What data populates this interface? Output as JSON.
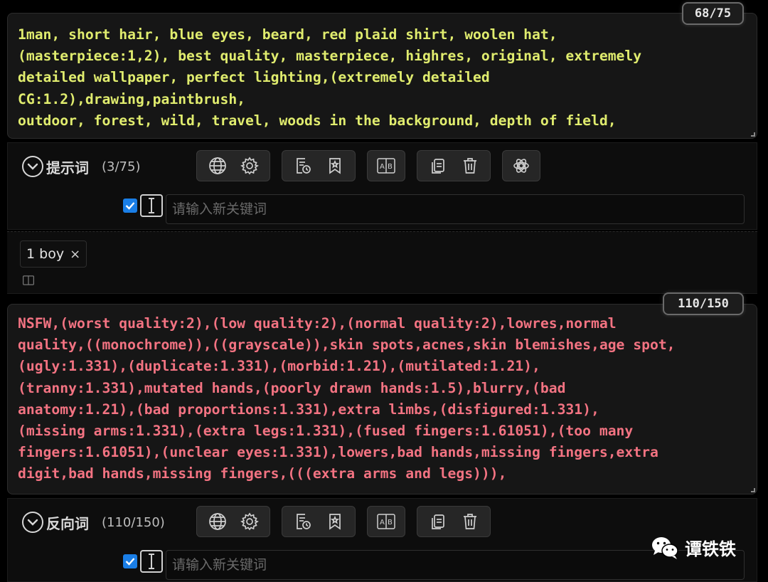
{
  "positive": {
    "text": "1man, short hair, blue eyes, beard, red plaid shirt, woolen hat,\n(masterpiece:1,2), best quality, masterpiece, highres, original, extremely\ndetailed wallpaper, perfect lighting,(extremely detailed\nCG:1.2),drawing,paintbrush,\noutdoor, forest, wild, travel, woods in the background, depth of field,",
    "counter": "68/75",
    "section_label": "提示词",
    "section_count": "(3/75)",
    "input_placeholder": "请输入新关键词",
    "tags": [
      {
        "label": "1 boy",
        "remove": "×"
      }
    ]
  },
  "negative": {
    "text": "NSFW,(worst quality:2),(low quality:2),(normal quality:2),lowres,normal\nquality,((monochrome)),((grayscale)),skin spots,acnes,skin blemishes,age spot,\n(ugly:1.331),(duplicate:1.331),(morbid:1.21),(mutilated:1.21),\n(tranny:1.331),mutated hands,(poorly drawn hands:1.5),blurry,(bad\nanatomy:1.21),(bad proportions:1.331),extra limbs,(disfigured:1.331),\n(missing arms:1.331),(extra legs:1.331),(fused fingers:1.61051),(too many\nfingers:1.61051),(unclear eyes:1.331),lowers,bad hands,missing fingers,extra\ndigit,bad hands,missing fingers,(((extra arms and legs))),",
    "counter": "110/150",
    "section_label": "反向词",
    "section_count": "(110/150)",
    "input_placeholder": "请输入新关键词"
  },
  "toolbar_icons": [
    "globe-icon",
    "gear-icon",
    "history-icon",
    "bookmark-icon",
    "translate-icon",
    "copy-icon",
    "trash-icon",
    "openai-icon"
  ],
  "watermark": {
    "icon": "wechat-icon",
    "text": "谭铁铁"
  },
  "colors": {
    "positive_text": "#e0ec6e",
    "negative_text": "#f37382",
    "checkbox": "#1a7ee6"
  }
}
